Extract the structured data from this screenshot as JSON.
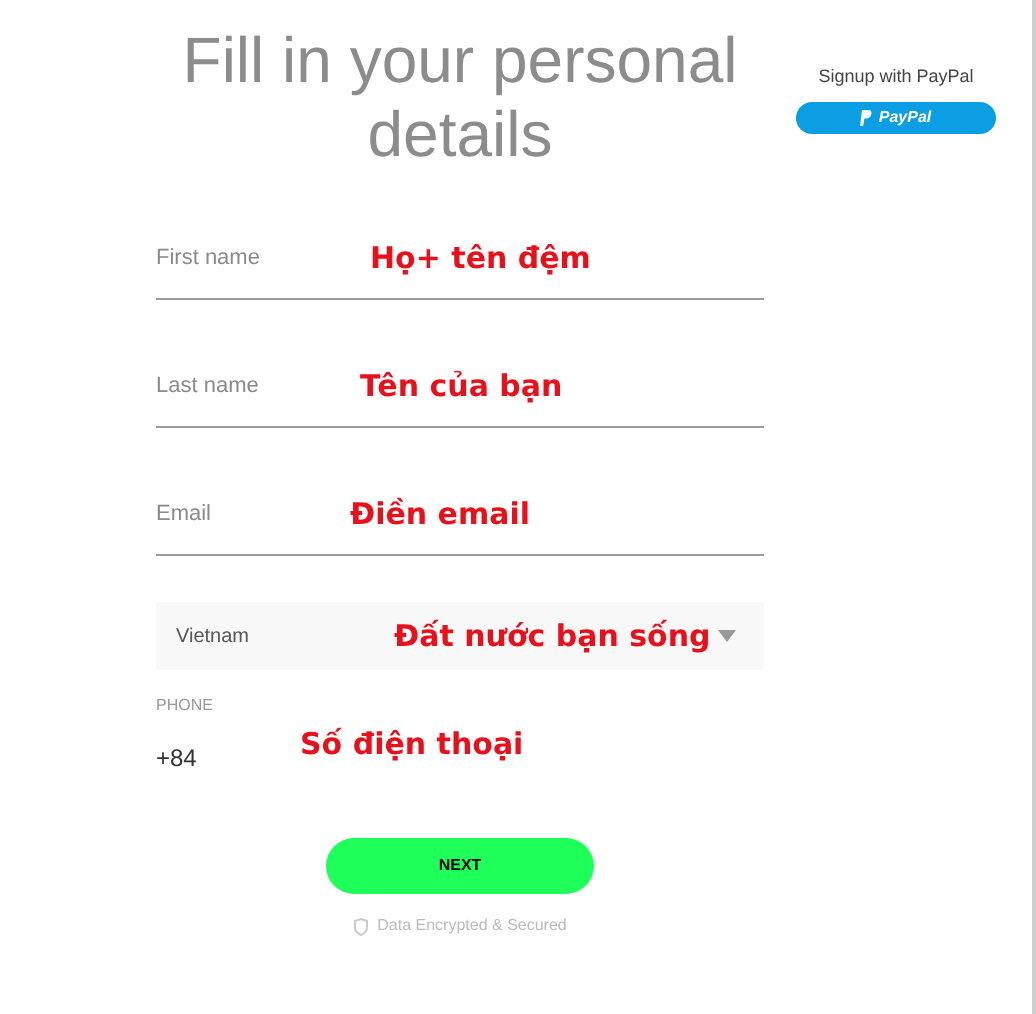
{
  "title": "Fill in your personal details",
  "paypal": {
    "caption": "Signup with PayPal",
    "button": "PayPal"
  },
  "fields": [
    {
      "kind": "text",
      "placeholder": "First name",
      "annotation": "Họ+ tên đệm"
    },
    {
      "kind": "text",
      "placeholder": "Last name",
      "annotation": "Tên của bạn"
    },
    {
      "kind": "text",
      "placeholder": "Email",
      "annotation": "Điền email"
    },
    {
      "kind": "select",
      "value": "Vietnam",
      "annotation": "Đất nước bạn sống"
    },
    {
      "kind": "phone",
      "label": "PHONE",
      "value": "+84",
      "annotation": "Số điện thoại"
    }
  ],
  "button": "NEXT",
  "footer": "Data Encrypted & Secured"
}
